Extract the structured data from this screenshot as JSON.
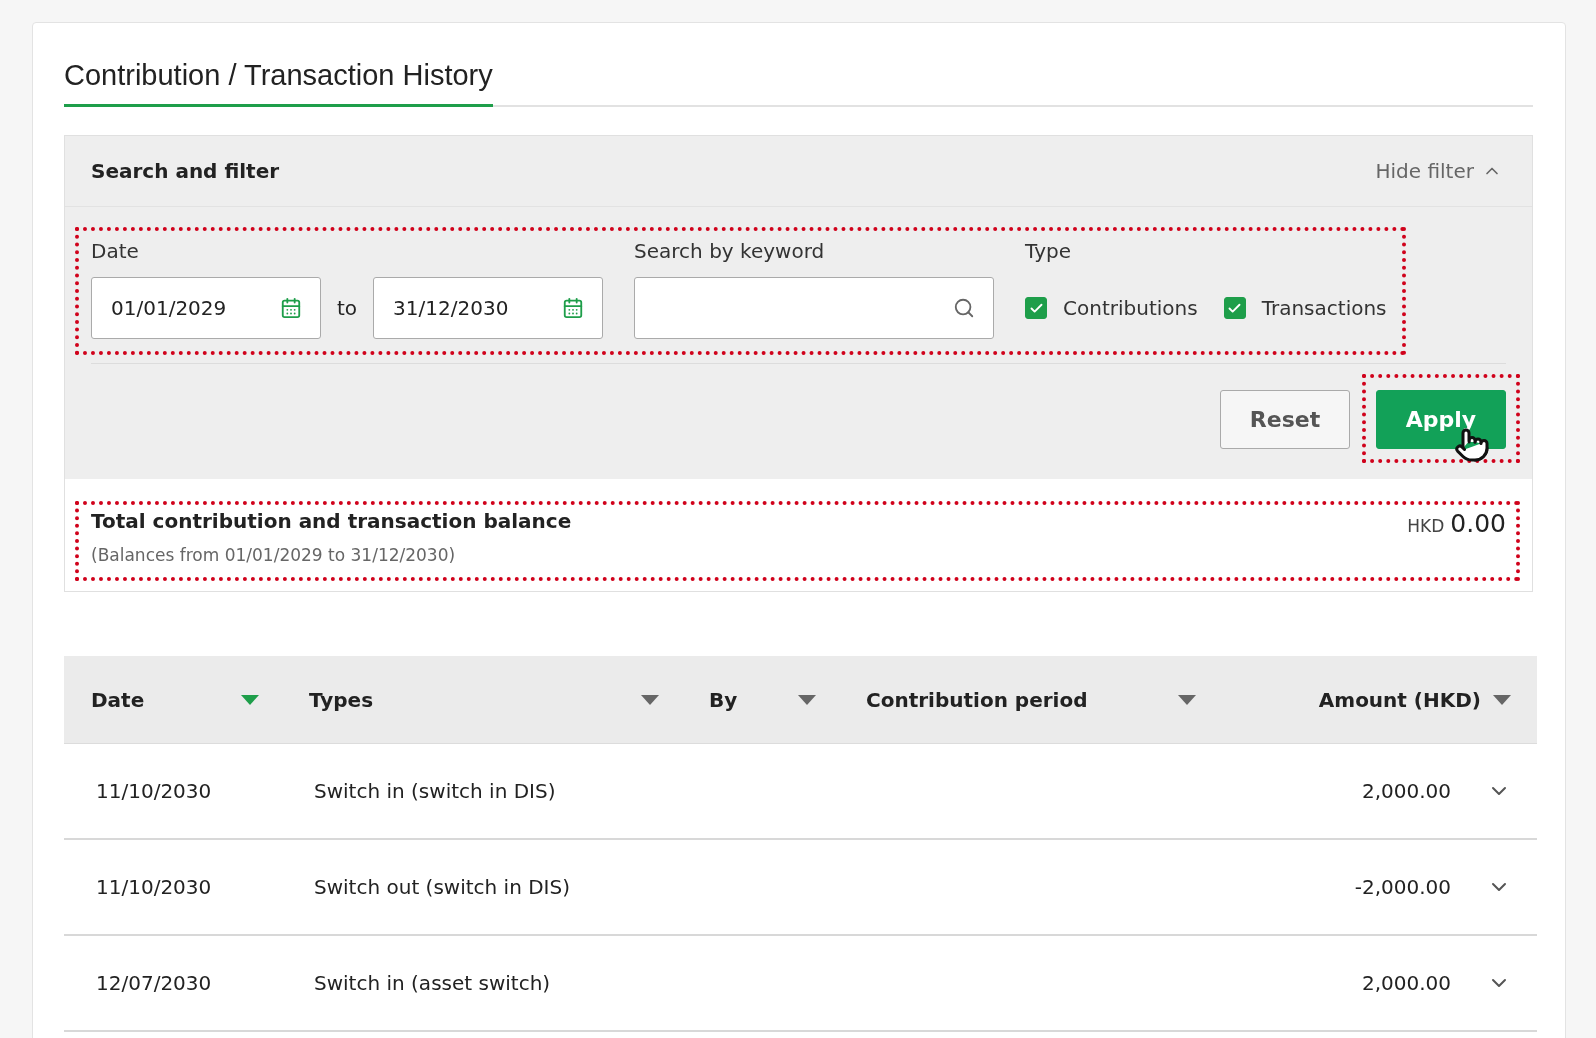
{
  "title": "Contribution / Transaction History",
  "filter": {
    "heading": "Search and filter",
    "toggle": "Hide filter",
    "expanded": true,
    "date_label": "Date",
    "date_from": "01/01/2029",
    "separator": "to",
    "date_to": "31/12/2030",
    "keyword_label": "Search by keyword",
    "type_label": "Type",
    "types": [
      {
        "label": "Contributions",
        "checked": true
      },
      {
        "label": "Transactions",
        "checked": true
      }
    ],
    "buttons": [
      {
        "label": "Reset",
        "kind": "secondary"
      },
      {
        "label": "Apply",
        "kind": "primary"
      }
    ]
  },
  "balance": {
    "title": "Total contribution and transaction balance",
    "note": "(Balances from 01/01/2029 to 31/12/2030)",
    "currency": "HKD",
    "amount": "0.00"
  },
  "table": {
    "columns": [
      {
        "label": "Date",
        "sorted": true
      },
      {
        "label": "Types",
        "sorted": false
      },
      {
        "label": "By",
        "sorted": false
      },
      {
        "label": "Contribution period",
        "sorted": false
      },
      {
        "label": "Amount (HKD)",
        "sorted": false
      }
    ],
    "rows": [
      {
        "date": "11/10/2030",
        "type": "Switch in (switch in DIS)",
        "amount": "2,000.00"
      },
      {
        "date": "11/10/2030",
        "type": "Switch out (switch in DIS)",
        "amount": "-2,000.00"
      },
      {
        "date": "12/07/2030",
        "type": "Switch in (asset switch)",
        "amount": "2,000.00"
      }
    ]
  }
}
